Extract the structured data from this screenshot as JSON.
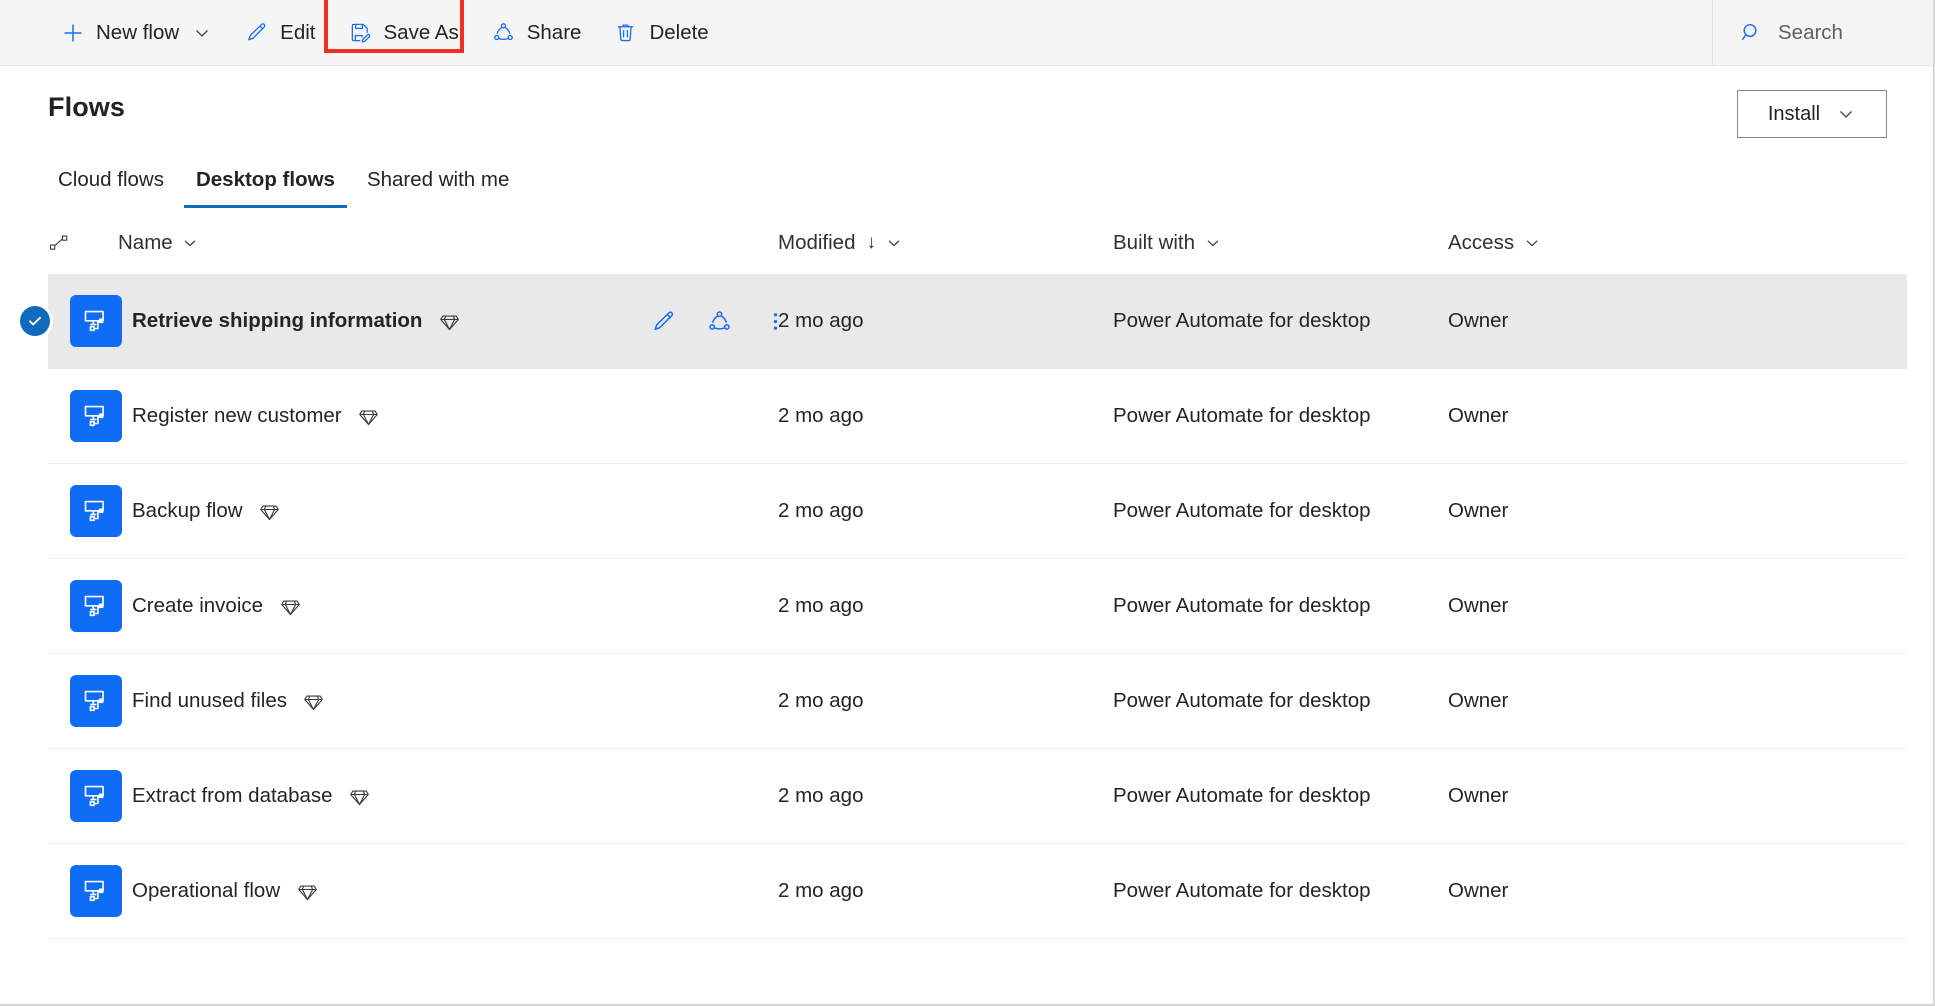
{
  "commandbar": {
    "buttons": [
      {
        "label": "New flow",
        "icon": "plus-icon",
        "has_chevron": true
      },
      {
        "label": "Edit",
        "icon": "pencil-icon",
        "has_chevron": false
      },
      {
        "label": "Save As",
        "icon": "save-as-icon",
        "has_chevron": false,
        "highlighted": true
      },
      {
        "label": "Share",
        "icon": "share-icon",
        "has_chevron": false
      },
      {
        "label": "Delete",
        "icon": "trash-icon",
        "has_chevron": false
      }
    ],
    "search": {
      "placeholder": "Search",
      "value": "",
      "icon": "search-icon"
    },
    "highlight_color": "#ef3124"
  },
  "header": {
    "title": "Flows",
    "install_label": "Install",
    "install_icon": "chevron-down-icon"
  },
  "tabs": [
    {
      "label": "Cloud flows",
      "active": false
    },
    {
      "label": "Desktop flows",
      "active": true
    },
    {
      "label": "Shared with me",
      "active": false
    }
  ],
  "table": {
    "columns": [
      {
        "label": "Name",
        "sortable": true,
        "sorted": false
      },
      {
        "label": "Modified",
        "sortable": true,
        "sorted": true,
        "sort_direction": "↓"
      },
      {
        "label": "Built with",
        "sortable": true,
        "sorted": false
      },
      {
        "label": "Access",
        "sortable": true,
        "sorted": false
      }
    ],
    "row_actions": [
      {
        "name": "edit",
        "icon": "pencil-icon"
      },
      {
        "name": "share",
        "icon": "share-icon"
      },
      {
        "name": "more",
        "icon": "more-vertical-icon"
      }
    ],
    "rows": [
      {
        "name": "Retrieve shipping information",
        "modified": "2 mo ago",
        "built_with": "Power Automate for desktop",
        "access": "Owner",
        "selected": true,
        "premium": true
      },
      {
        "name": "Register new customer",
        "modified": "2 mo ago",
        "built_with": "Power Automate for desktop",
        "access": "Owner",
        "selected": false,
        "premium": true
      },
      {
        "name": "Backup flow",
        "modified": "2 mo ago",
        "built_with": "Power Automate for desktop",
        "access": "Owner",
        "selected": false,
        "premium": true
      },
      {
        "name": "Create invoice",
        "modified": "2 mo ago",
        "built_with": "Power Automate for desktop",
        "access": "Owner",
        "selected": false,
        "premium": true
      },
      {
        "name": "Find unused files",
        "modified": "2 mo ago",
        "built_with": "Power Automate for desktop",
        "access": "Owner",
        "selected": false,
        "premium": true
      },
      {
        "name": "Extract from database",
        "modified": "2 mo ago",
        "built_with": "Power Automate for desktop",
        "access": "Owner",
        "selected": false,
        "premium": true
      },
      {
        "name": "Operational flow",
        "modified": "2 mo ago",
        "built_with": "Power Automate for desktop",
        "access": "Owner",
        "selected": false,
        "premium": true
      }
    ]
  },
  "colors": {
    "accent_blue": "#0f6cf5",
    "tab_underline": "#0f6cbd",
    "icon_blue": "#1a6ef5",
    "selected_row": "#e9e9e9",
    "commandbar_bg": "#f5f5f5"
  }
}
